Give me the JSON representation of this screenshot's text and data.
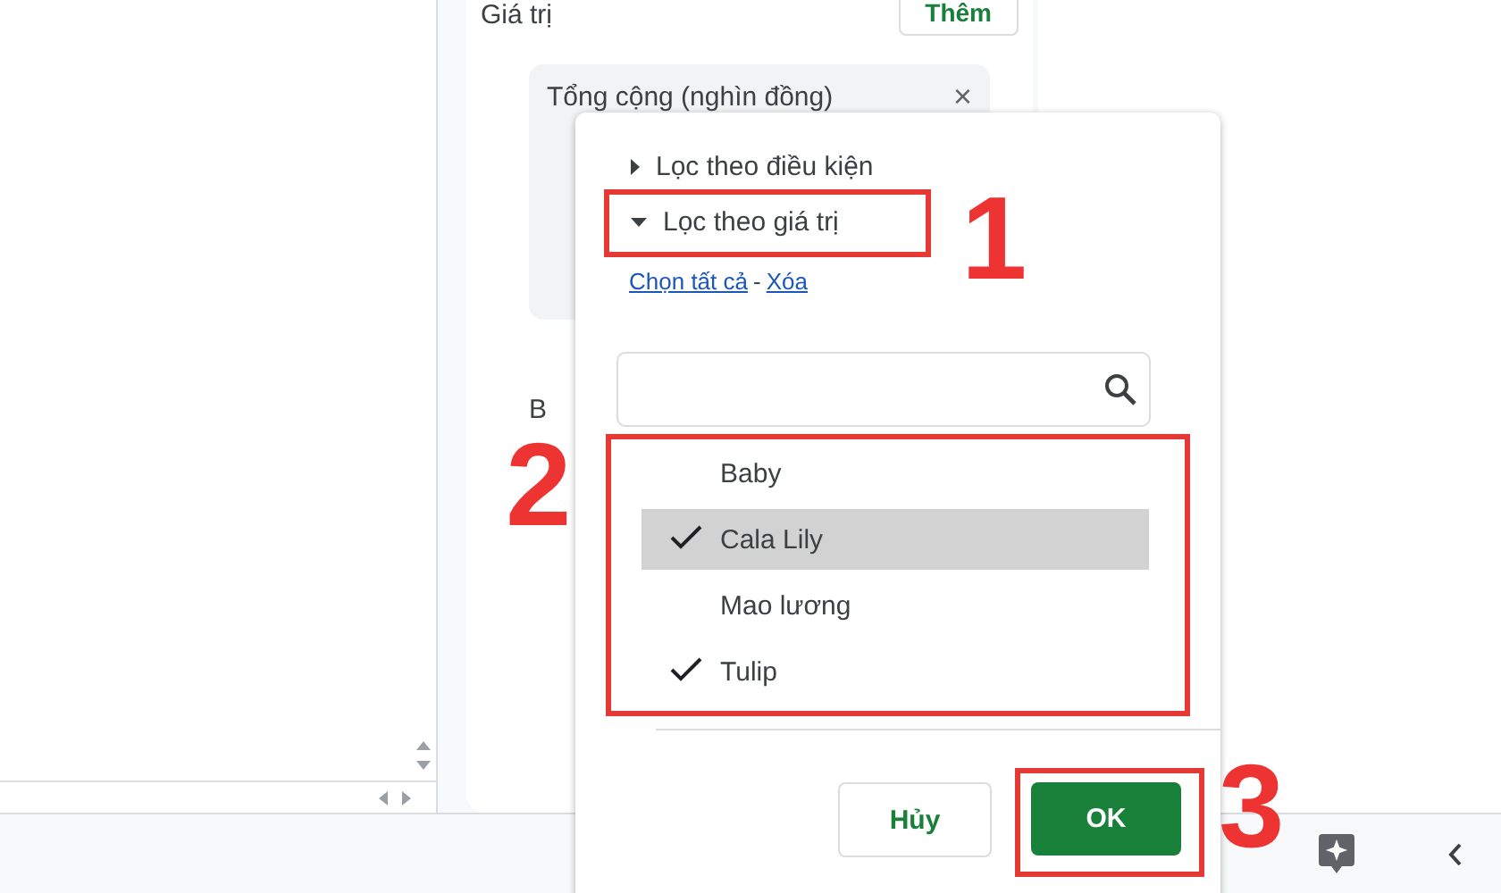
{
  "side_panel": {
    "values_label": "Giá trị",
    "add_button": "Thêm",
    "value_chip": "Tổng cộng (nghìn đồng)",
    "close_glyph": "×",
    "cut_label": "B"
  },
  "filter_menu": {
    "sections": [
      {
        "label": "Lọc theo điều kiện",
        "expanded": false
      },
      {
        "label": "Lọc theo giá trị",
        "expanded": true
      }
    ],
    "select_all_link": "Chọn tất cả",
    "separator": "-",
    "clear_link": "Xóa",
    "items": [
      {
        "label": "Baby",
        "checked": false,
        "selected": false
      },
      {
        "label": "Cala Lily",
        "checked": true,
        "selected": true
      },
      {
        "label": "Mao lương",
        "checked": false,
        "selected": false
      },
      {
        "label": "Tulip",
        "checked": true,
        "selected": false
      }
    ],
    "cancel_button": "Hủy",
    "ok_button": "OK"
  },
  "annotations": [
    {
      "label": "1"
    },
    {
      "label": "2"
    },
    {
      "label": "3"
    }
  ]
}
